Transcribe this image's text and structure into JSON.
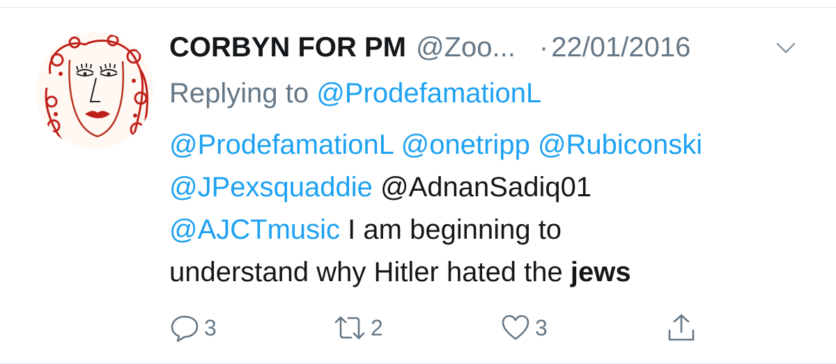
{
  "tweet": {
    "display_name": "CORBYN FOR PM",
    "handle": "@Zoo...",
    "separator": "·",
    "date": "22/01/2016",
    "reply_prefix": "Replying to ",
    "reply_to": "@ProdefamationL",
    "text_lines": [
      [
        "@ProdefamationL",
        " ",
        "@onetripp",
        " ",
        "@Rubiconski"
      ],
      [
        "@JPexsquaddie",
        " @AdnanSadiq01"
      ],
      [
        "@AJCTmusic",
        " I am beginning to"
      ],
      [
        "understand why Hitler hated the ",
        "jews"
      ]
    ]
  },
  "actions": {
    "reply_count": "3",
    "retweet_count": "2",
    "like_count": "3"
  },
  "colors": {
    "link": "#1da1f2",
    "secondary": "#657786",
    "primary": "#14171a",
    "avatar_accent": "#c0201a"
  },
  "icons": {
    "reply": "reply-icon",
    "retweet": "retweet-icon",
    "like": "heart-icon",
    "share": "share-icon",
    "caret": "chevron-down-icon"
  }
}
